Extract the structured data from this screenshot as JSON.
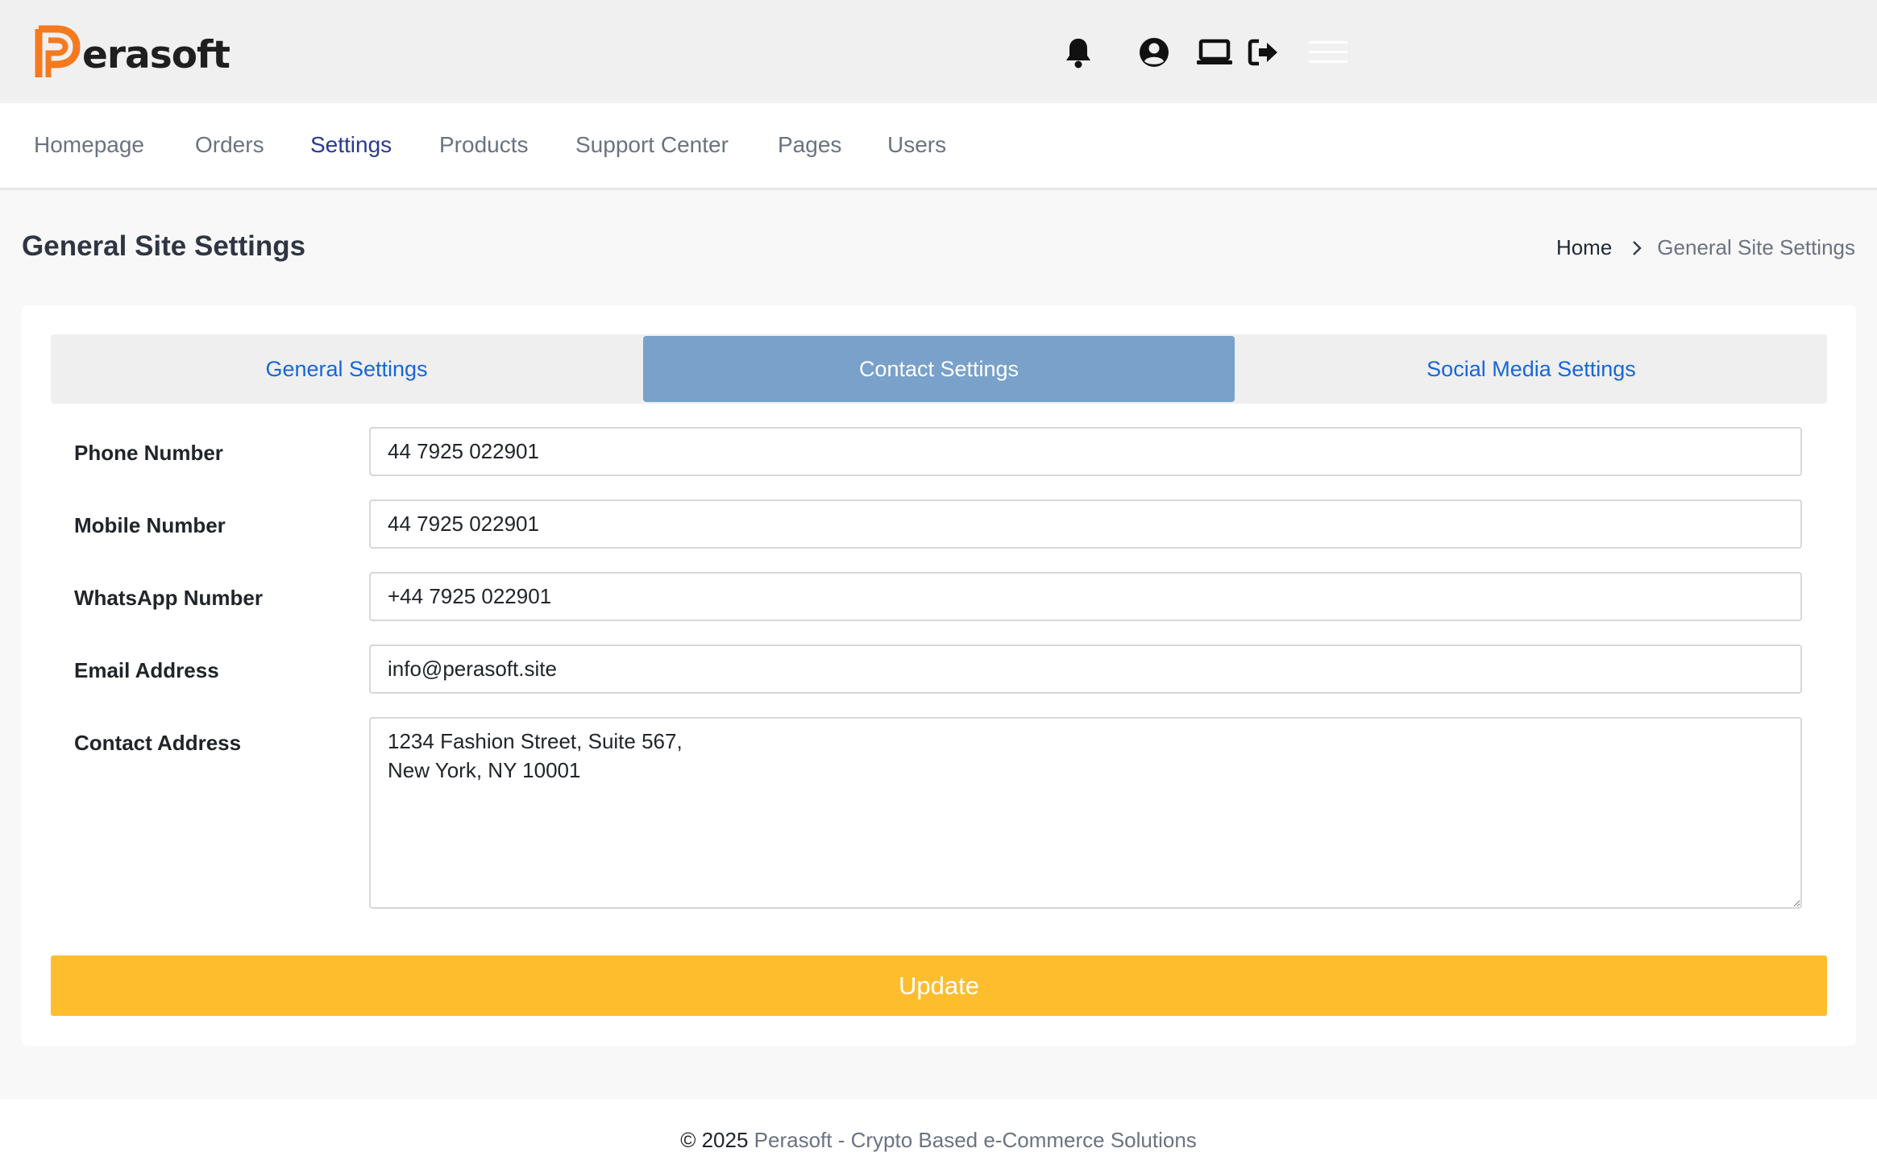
{
  "brand": {
    "name": "erasoft",
    "logo_color": "#f47a1f",
    "logo_icon": "perasoft-p-logo"
  },
  "header_icons": [
    {
      "name": "bell-icon"
    },
    {
      "name": "user-circle-icon"
    },
    {
      "name": "laptop-icon"
    },
    {
      "name": "logout-icon"
    },
    {
      "name": "hamburger-menu-icon"
    }
  ],
  "nav": {
    "items": [
      {
        "label": "Homepage",
        "active": false
      },
      {
        "label": "Orders",
        "active": false
      },
      {
        "label": "Settings",
        "active": true
      },
      {
        "label": "Products",
        "active": false
      },
      {
        "label": "Support Center",
        "active": false
      },
      {
        "label": "Pages",
        "active": false
      },
      {
        "label": "Users",
        "active": false
      }
    ]
  },
  "page": {
    "title": "General Site Settings",
    "breadcrumb": {
      "home": "Home",
      "current": "General Site Settings"
    }
  },
  "tabs": {
    "items": [
      {
        "label": "General Settings",
        "active": false
      },
      {
        "label": "Contact Settings",
        "active": true
      },
      {
        "label": "Social Media Settings",
        "active": false
      }
    ],
    "active_color": "#79a1c9",
    "link_color": "#1766d8"
  },
  "form": {
    "phone": {
      "label": "Phone Number",
      "value": "44 7925 022901"
    },
    "mobile": {
      "label": "Mobile Number",
      "value": "44 7925 022901"
    },
    "whatsapp": {
      "label": "WhatsApp Number",
      "value": "+44 7925 022901"
    },
    "email": {
      "label": "Email Address",
      "value": "info@perasoft.site"
    },
    "address": {
      "label": "Contact Address",
      "value": "1234 Fashion Street, Suite 567,\nNew York, NY 10001"
    },
    "submit_label": "Update",
    "submit_color": "#fdbd2d"
  },
  "footer": {
    "copyright": "© 2025",
    "text": "Perasoft - Crypto Based e-Commerce Solutions"
  }
}
